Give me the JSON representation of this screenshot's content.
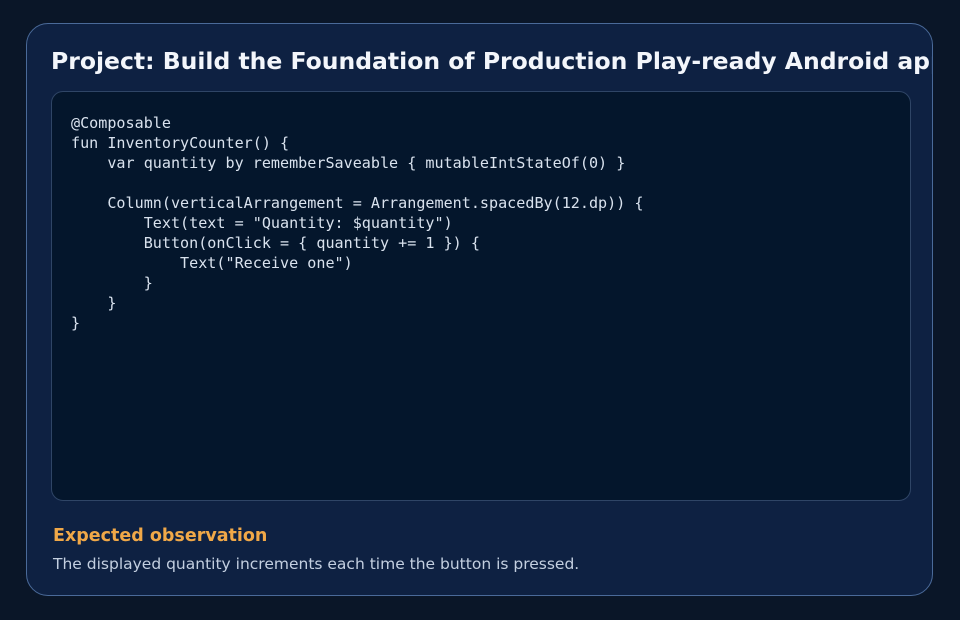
{
  "card": {
    "title": "Project: Build the Foundation of Production Play-ready Android app",
    "code": "@Composable\nfun InventoryCounter() {\n    var quantity by rememberSaveable { mutableIntStateOf(0) }\n\n    Column(verticalArrangement = Arrangement.spacedBy(12.dp)) {\n        Text(text = \"Quantity: $quantity\")\n        Button(onClick = { quantity += 1 }) {\n            Text(\"Receive one\")\n        }\n    }\n}",
    "observation": {
      "heading": "Expected observation",
      "text": "The displayed quantity increments each time the button is pressed."
    }
  },
  "colors": {
    "background": "#0a1628",
    "card": "#0e2142",
    "card_border": "#4a6a99",
    "code_background": "#04162c",
    "accent": "#f0a848"
  }
}
